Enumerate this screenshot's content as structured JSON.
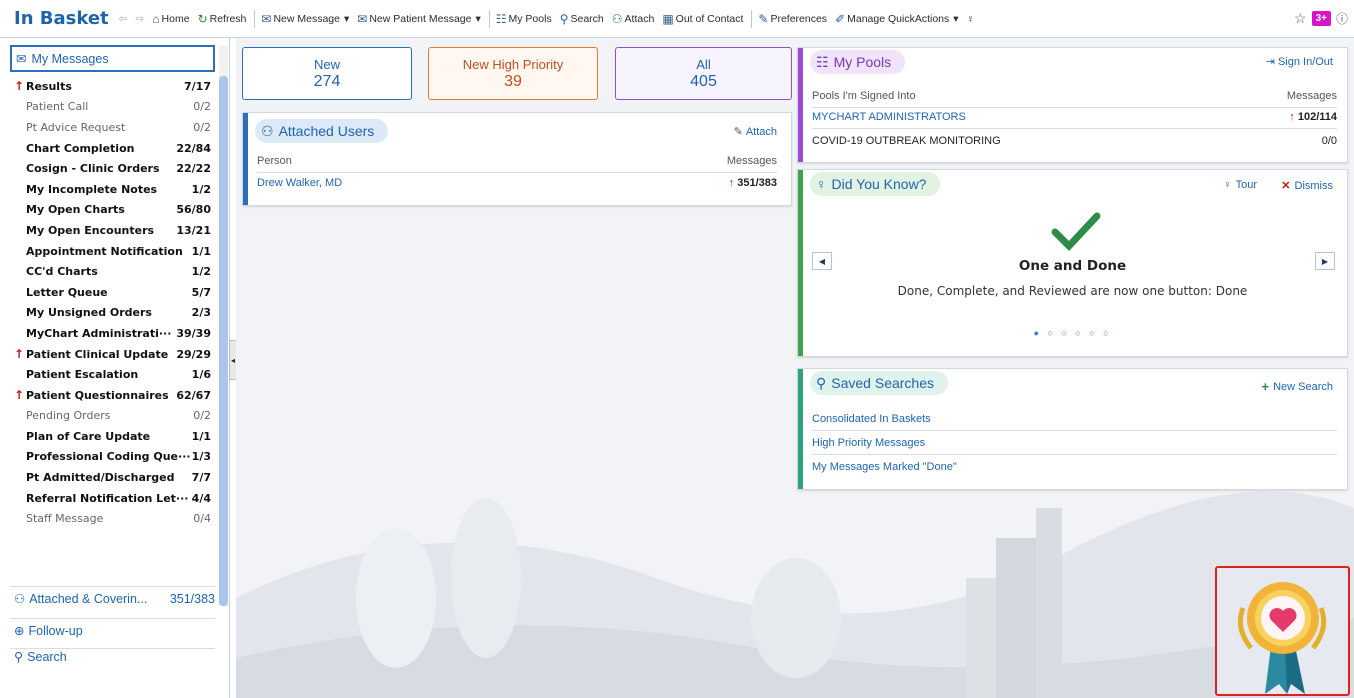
{
  "toolbar": {
    "title": "In Basket",
    "home": "Home",
    "refresh": "Refresh",
    "new_message": "New Message",
    "new_patient_message": "New Patient Message",
    "my_pools": "My Pools",
    "search": "Search",
    "attach": "Attach",
    "out_of_contact": "Out of Contact",
    "preferences": "Preferences",
    "manage_quickactions": "Manage QuickActions",
    "notif_badge": "3+"
  },
  "sidebar": {
    "header": "My Messages",
    "folders": [
      {
        "name": "Results",
        "count": "7/17",
        "bold": true,
        "priority": true
      },
      {
        "name": "Patient Call",
        "count": "0/2",
        "bold": false,
        "priority": false
      },
      {
        "name": "Pt Advice Request",
        "count": "0/2",
        "bold": false,
        "priority": false
      },
      {
        "name": "Chart Completion",
        "count": "22/84",
        "bold": true,
        "priority": false
      },
      {
        "name": "Cosign - Clinic Orders",
        "count": "22/22",
        "bold": true,
        "priority": false
      },
      {
        "name": "My Incomplete Notes",
        "count": "1/2",
        "bold": true,
        "priority": false
      },
      {
        "name": "My Open Charts",
        "count": "56/80",
        "bold": true,
        "priority": false
      },
      {
        "name": "My Open Encounters",
        "count": "13/21",
        "bold": true,
        "priority": false
      },
      {
        "name": "Appointment Notification",
        "count": "1/1",
        "bold": true,
        "priority": false
      },
      {
        "name": "CC'd Charts",
        "count": "1/2",
        "bold": true,
        "priority": false
      },
      {
        "name": "Letter Queue",
        "count": "5/7",
        "bold": true,
        "priority": false
      },
      {
        "name": "My Unsigned Orders",
        "count": "2/3",
        "bold": true,
        "priority": false
      },
      {
        "name": "MyChart Administrati···",
        "count": "39/39",
        "bold": true,
        "priority": false
      },
      {
        "name": "Patient Clinical Update",
        "count": "29/29",
        "bold": true,
        "priority": true
      },
      {
        "name": "Patient Escalation",
        "count": "1/6",
        "bold": true,
        "priority": false
      },
      {
        "name": "Patient Questionnaires",
        "count": "62/67",
        "bold": true,
        "priority": true
      },
      {
        "name": "Pending Orders",
        "count": "0/2",
        "bold": false,
        "priority": false
      },
      {
        "name": "Plan of Care Update",
        "count": "1/1",
        "bold": true,
        "priority": false
      },
      {
        "name": "Professional Coding Que···",
        "count": "1/3",
        "bold": true,
        "priority": false
      },
      {
        "name": "Pt Admitted/Discharged",
        "count": "7/7",
        "bold": true,
        "priority": false
      },
      {
        "name": "Referral Notification Let···",
        "count": "4/4",
        "bold": true,
        "priority": false
      },
      {
        "name": "Staff Message",
        "count": "0/4",
        "bold": false,
        "priority": false
      }
    ],
    "attached_covering": "Attached & Coverin...",
    "attached_covering_count": "351/383",
    "follow_up": "Follow-up",
    "search": "Search"
  },
  "counts": {
    "new_label": "New",
    "new_value": "274",
    "high_label": "New High Priority",
    "high_value": "39",
    "all_label": "All",
    "all_value": "405"
  },
  "attached_users": {
    "title": "Attached Users",
    "attach": "Attach",
    "col_person": "Person",
    "col_messages": "Messages",
    "rows": [
      {
        "person": "Drew Walker, MD",
        "messages": "351/383"
      }
    ]
  },
  "my_pools": {
    "title": "My Pools",
    "sign_in_out": "Sign In/Out",
    "col_pools": "Pools I'm Signed Into",
    "col_messages": "Messages",
    "rows": [
      {
        "name": "MYCHART ADMINISTRATORS",
        "messages": "102/114"
      },
      {
        "name": "COVID-19 OUTBREAK MONITORING",
        "messages": "0/0"
      }
    ]
  },
  "did_you_know": {
    "title": "Did You Know?",
    "tour": "Tour",
    "dismiss": "Dismiss",
    "heading": "One and Done",
    "body": "Done, Complete, and Reviewed are now one button: Done",
    "dots": "● ○ ○ ○ ○ ○"
  },
  "saved_searches": {
    "title": "Saved Searches",
    "new_search": "New Search",
    "items": [
      "Consolidated In Baskets",
      "High Priority Messages",
      "My Messages Marked \"Done\""
    ]
  },
  "colors": {
    "accent": "#1f64ad",
    "priority_red": "#c81818",
    "new_border": "#2c6fb8",
    "high_border": "#e07c37",
    "all_border": "#8a54c8",
    "pools_stripe": "#9b4bd8",
    "dyk_stripe": "#3fa34d",
    "saved_stripe": "#2aa37c"
  }
}
